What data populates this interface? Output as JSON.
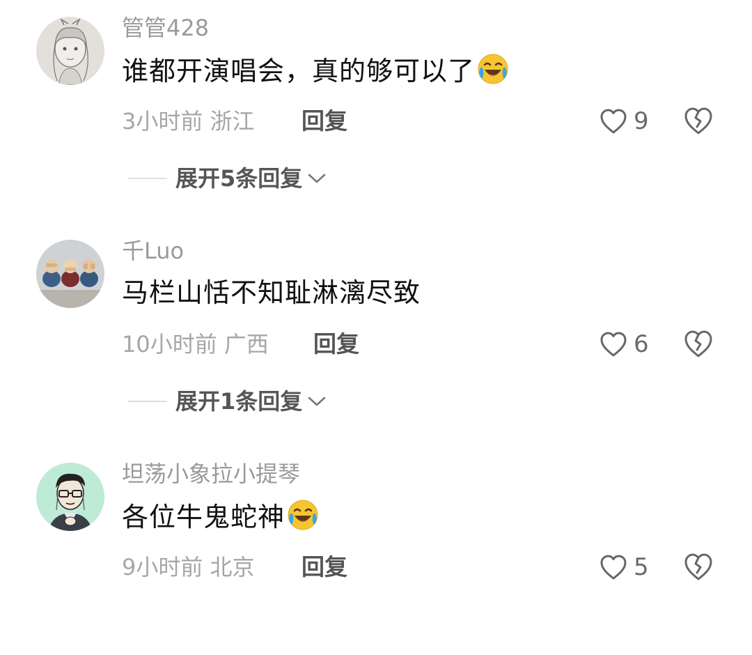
{
  "comments": [
    {
      "username": "管管428",
      "text": "谁都开演唱会，真的够可以了",
      "emoji": "laughing-crying-emoji",
      "time": "3小时前",
      "location": "浙江",
      "reply_label": "回复",
      "likes": "9",
      "expand_label": "展开5条回复"
    },
    {
      "username": "千Luo",
      "text": "马栏山恬不知耻淋漓尽致",
      "emoji": "",
      "time": "10小时前",
      "location": "广西",
      "reply_label": "回复",
      "likes": "6",
      "expand_label": "展开1条回复"
    },
    {
      "username": "坦荡小象拉小提琴",
      "text": "各位牛鬼蛇神",
      "emoji": "laughing-crying-emoji",
      "time": "9小时前",
      "location": "北京",
      "reply_label": "回复",
      "likes": "5",
      "expand_label": ""
    }
  ],
  "icons": {
    "like": "heart-outline-icon",
    "dislike": "broken-heart-icon",
    "expand": "chevron-down-icon"
  },
  "colors": {
    "username": "#9a9a9a",
    "text": "#111111",
    "meta": "#a6a6a6",
    "action": "#555555"
  }
}
